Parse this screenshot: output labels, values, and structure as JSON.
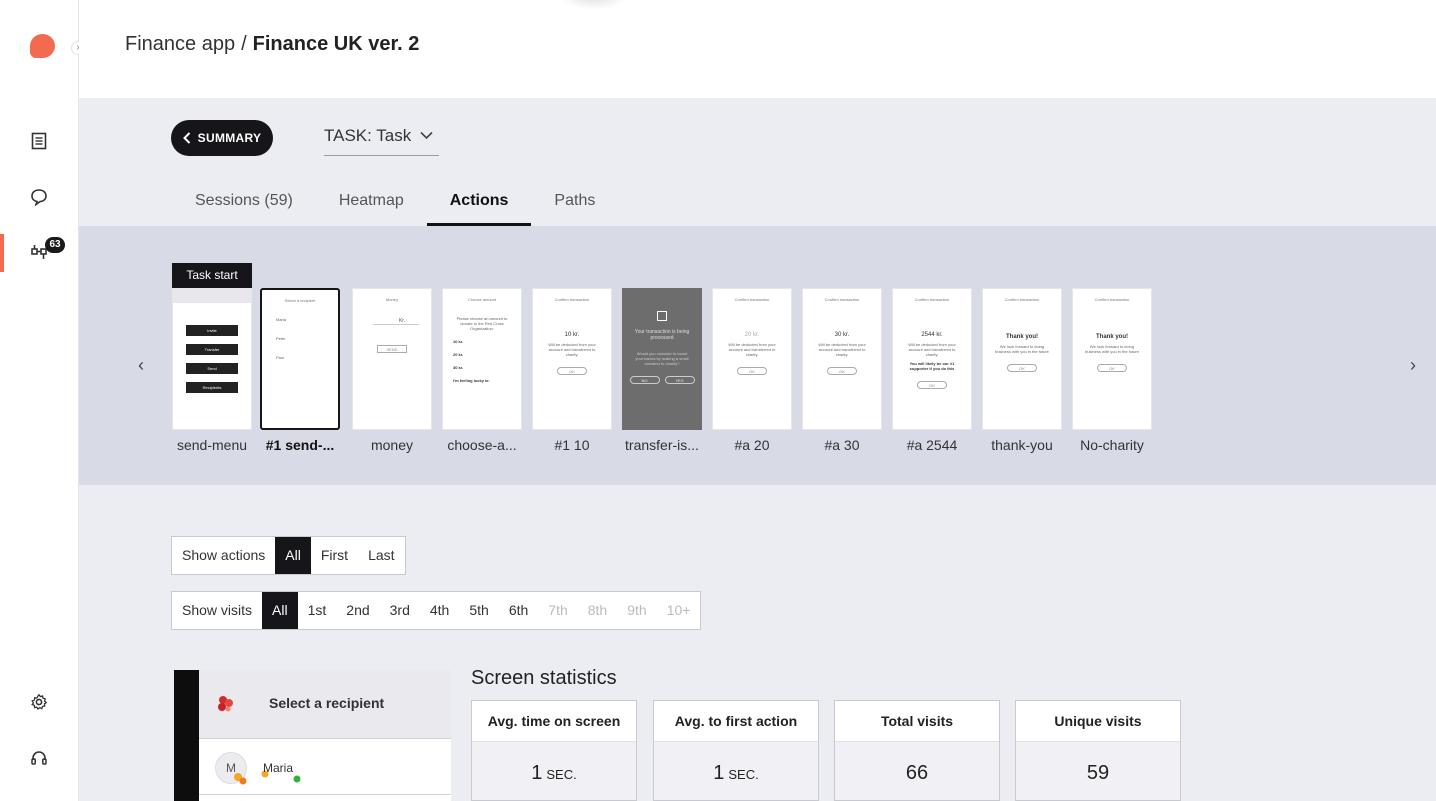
{
  "sidebar": {
    "badge_count": "63",
    "icons": [
      "logo-icon",
      "document-icon",
      "chat-bubble-icon",
      "flow-icon",
      "gear-icon",
      "headset-icon"
    ]
  },
  "breadcrumb": {
    "parent": "Finance app",
    "separator": "/",
    "current": "Finance UK ver. 2"
  },
  "toolbar": {
    "summary_label": "SUMMARY",
    "task_label": "TASK: Task"
  },
  "tabs": [
    {
      "label": "Sessions (59)"
    },
    {
      "label": "Heatmap"
    },
    {
      "label": "Actions"
    },
    {
      "label": "Paths"
    }
  ],
  "strip": {
    "task_start_label": "Task start",
    "screens": [
      {
        "label": "send-menu"
      },
      {
        "label": "#1 send-..."
      },
      {
        "label": "money"
      },
      {
        "label": "choose-a..."
      },
      {
        "label": "#1 10"
      },
      {
        "label": "transfer-is..."
      },
      {
        "label": "#a 20"
      },
      {
        "label": "#a 30"
      },
      {
        "label": "#a 2544"
      },
      {
        "label": "thank-you"
      },
      {
        "label": "No-charity"
      }
    ],
    "mini": {
      "send_menu": [
        "Invite",
        "Transfer",
        "Send",
        "Recipients"
      ],
      "select_recipient": {
        "title": "Select a recipient",
        "names": [
          "Maria",
          "Peter",
          "Paul"
        ]
      },
      "money": {
        "title": "Money",
        "unit": "Kr.",
        "button": "SEND"
      },
      "choose_amount": {
        "title": "Choose amount",
        "text": "Please choose an amount to donate to the Red Cross Organization:",
        "options": [
          "10 kr.",
          "20 kr.",
          "30 kr.",
          "I'm feeling lucky kr."
        ]
      },
      "confirm_title": "Confirm transaction",
      "deduct_text": "Will be deducted from your account and transferred to charity.",
      "ok": "OK",
      "amounts": [
        "10 kr.",
        "20 kr.",
        "30 kr.",
        "2544 kr."
      ],
      "processing": {
        "title": "Your transaction is being processed",
        "text": "Would you consider to boost your karma by making a small donation to charity?",
        "no": "NO",
        "yes": "YES"
      },
      "lucky_note": "You will likely be our #1 supporter if you do this",
      "thanks": {
        "title": "Thank you!",
        "text": "We look forward to doing business with you in the future"
      }
    }
  },
  "filters": {
    "actions": {
      "label": "Show actions",
      "options": [
        "All",
        "First",
        "Last"
      ]
    },
    "visits": {
      "label": "Show visits",
      "options": [
        "All",
        "1st",
        "2nd",
        "3rd",
        "4th",
        "5th",
        "6th",
        "7th",
        "8th",
        "9th",
        "10+"
      ]
    }
  },
  "preview": {
    "title": "Select a recipient",
    "avatar_letter": "M",
    "name": "Maria"
  },
  "stats": {
    "title": "Screen statistics",
    "cards": [
      {
        "label": "Avg. time on screen",
        "value": "1",
        "unit": "SEC."
      },
      {
        "label": "Avg. to first action",
        "value": "1",
        "unit": "SEC."
      },
      {
        "label": "Total visits",
        "value": "66",
        "unit": ""
      },
      {
        "label": "Unique visits",
        "value": "59",
        "unit": ""
      }
    ]
  },
  "colors": {
    "accent": "#f26a50",
    "dark": "#15151a",
    "strip_bg": "#d8dae6",
    "page_bg": "#ecedf3"
  }
}
